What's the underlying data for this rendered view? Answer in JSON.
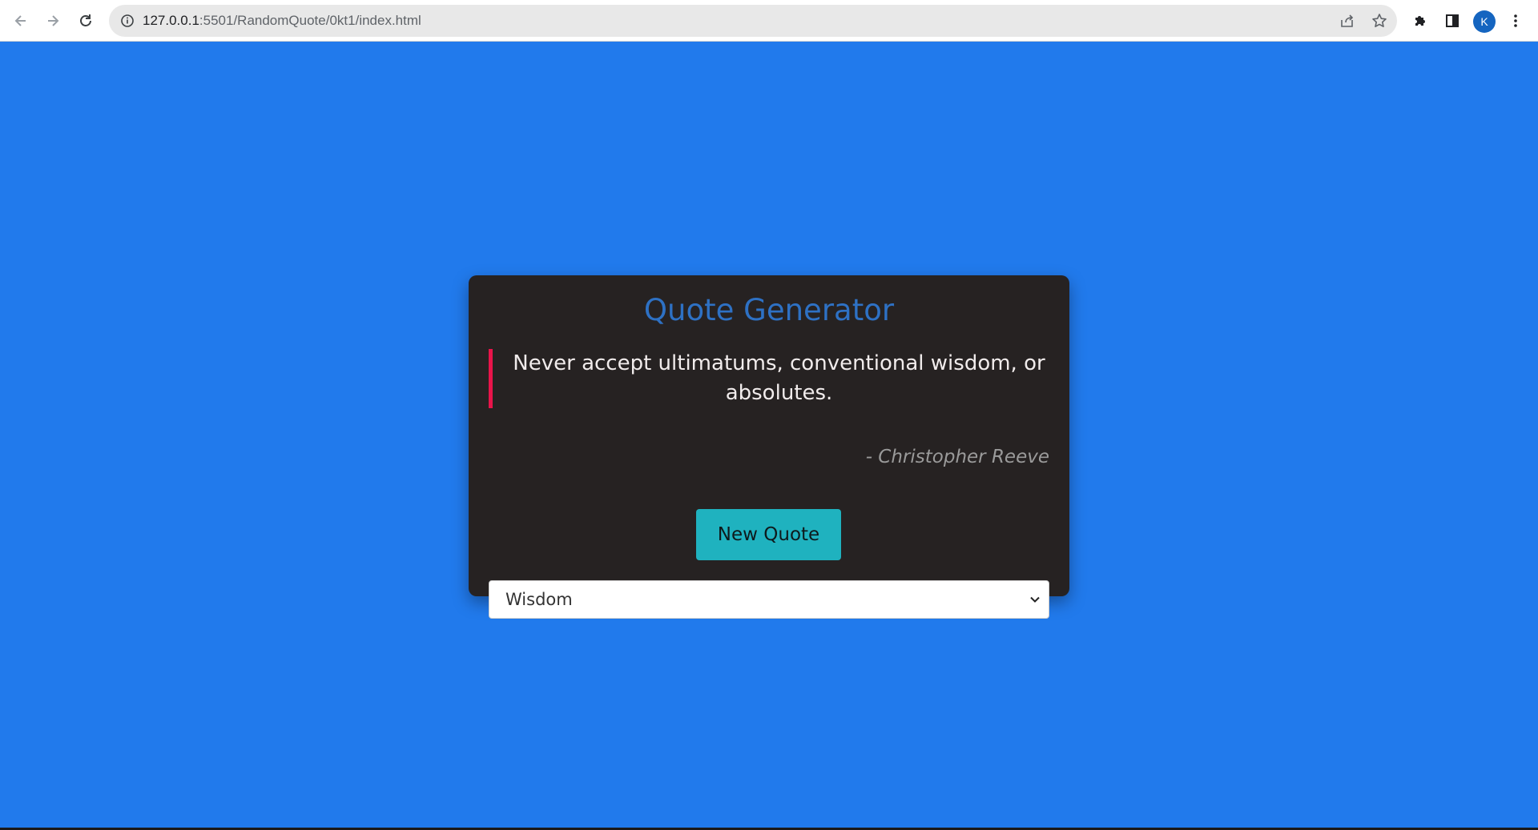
{
  "browser": {
    "url_host": "127.0.0.1",
    "url_path": ":5501/RandomQuote/0kt1/index.html",
    "avatar_letter": "K",
    "icons": [
      "back-arrow-icon",
      "forward-arrow-icon",
      "reload-icon",
      "info-icon",
      "share-icon",
      "star-icon",
      "puzzle-icon",
      "side-panel-icon",
      "kebab-menu-icon"
    ]
  },
  "page": {
    "background_color": "#217aec",
    "card_color": "#262222",
    "title": "Quote Generator",
    "title_color": "#2e71c4",
    "quote": "Never accept ultimatums, conventional wisdom, or absolutes.",
    "quote_border_color": "#e8144a",
    "author": "- Christopher Reeve",
    "button_label": "New Quote",
    "button_color": "#1fb2bf",
    "category_selected": "Wisdom"
  }
}
